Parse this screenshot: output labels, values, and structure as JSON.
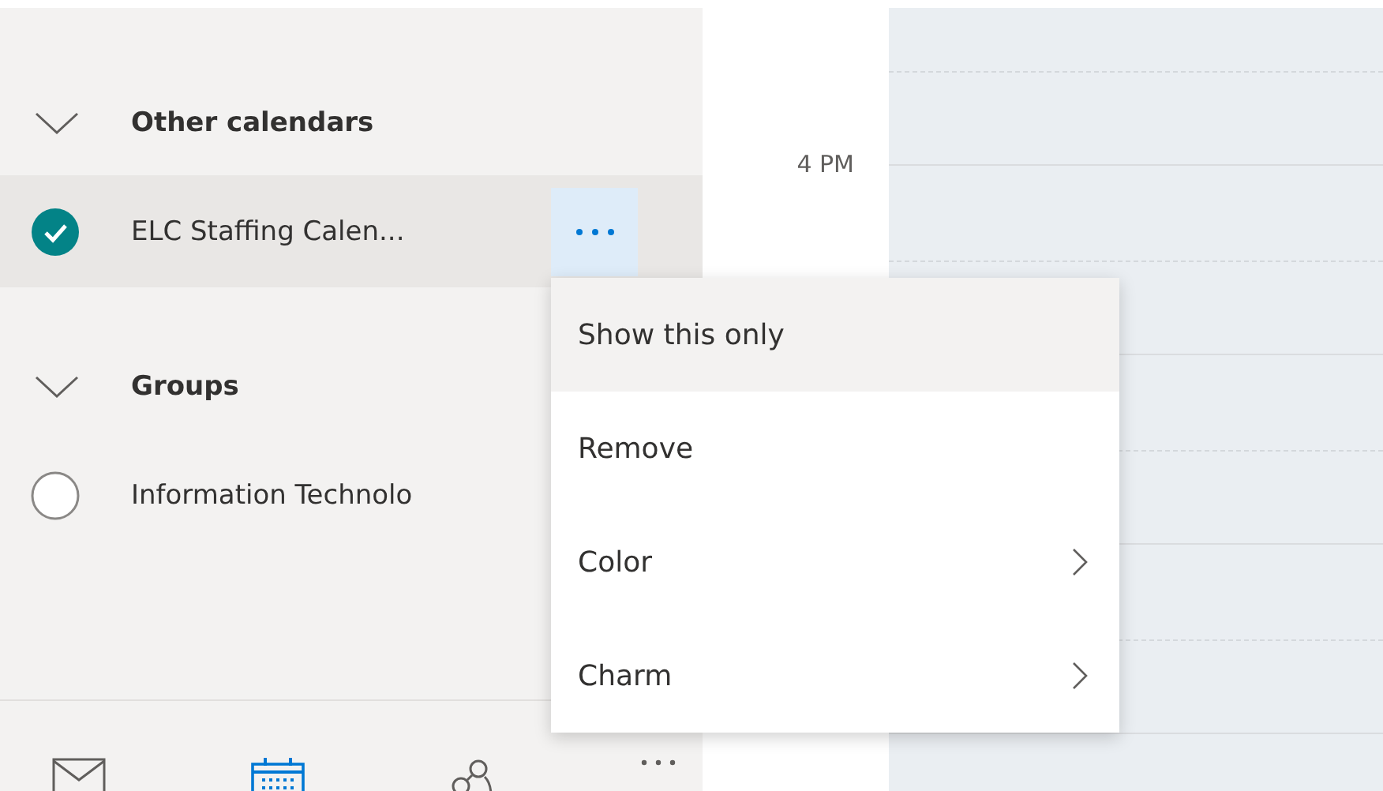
{
  "sidebar": {
    "sections": [
      {
        "title": "Other calendars",
        "expanded": true,
        "calendars": [
          {
            "name": "ELC Staffing Calen...",
            "checked": true,
            "selected": true
          }
        ]
      },
      {
        "title": "Groups",
        "expanded": true,
        "calendars": [
          {
            "name": "Information Technolo",
            "checked": false,
            "selected": false
          }
        ]
      }
    ],
    "nav": [
      {
        "kind": "mail",
        "selected": false
      },
      {
        "kind": "calendar",
        "selected": true
      },
      {
        "kind": "people",
        "selected": false
      },
      {
        "kind": "more",
        "selected": false
      }
    ]
  },
  "time_labels": [
    "4 PM"
  ],
  "context_menu": {
    "items": [
      {
        "label": "Show this only",
        "selected": true,
        "submenu": false
      },
      {
        "label": "Remove",
        "selected": false,
        "submenu": false
      },
      {
        "label": "Color",
        "selected": false,
        "submenu": true
      },
      {
        "label": "Charm",
        "selected": false,
        "submenu": true
      }
    ]
  }
}
